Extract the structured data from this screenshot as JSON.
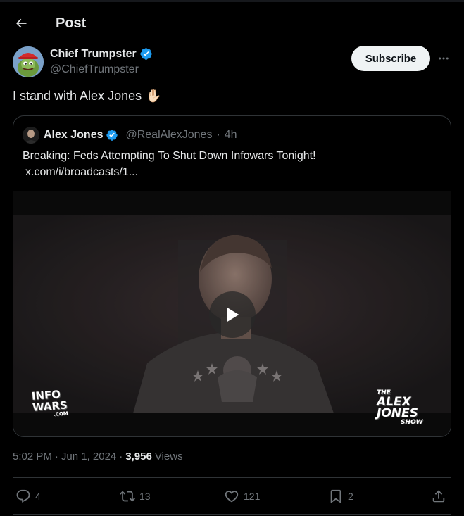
{
  "header": {
    "title": "Post"
  },
  "author": {
    "name": "Chief Trumpster",
    "handle": "@ChiefTrumpster",
    "verified_color": "#1d9bf0"
  },
  "subscribe_label": "Subscribe",
  "post": {
    "text": "I stand with Alex Jones",
    "emoji": "✋🏻"
  },
  "quote": {
    "name": "Alex Jones",
    "handle": "@RealAlexJones",
    "time": "4h",
    "text": "Breaking: Feds Attempting To Shut Down Infowars Tonight!",
    "link": "x.com/i/broadcasts/1..."
  },
  "video": {
    "left_logo": {
      "line1": "INFO",
      "line2": "WARS",
      "sub": ".COM"
    },
    "right_logo": {
      "line1": "THE",
      "line2": "ALEX",
      "line3": "JONES",
      "line4": "SHOW"
    }
  },
  "meta": {
    "time": "5:02 PM",
    "date": "Jun 1, 2024",
    "views": "3,956",
    "views_label": "Views"
  },
  "actions": {
    "replies": "4",
    "reposts": "13",
    "likes": "121",
    "bookmarks": "2"
  },
  "colors": {
    "background": "#000000",
    "text": "#e7e9ea",
    "muted": "#71767b",
    "verified": "#1d9bf0",
    "border": "#2f3336"
  }
}
